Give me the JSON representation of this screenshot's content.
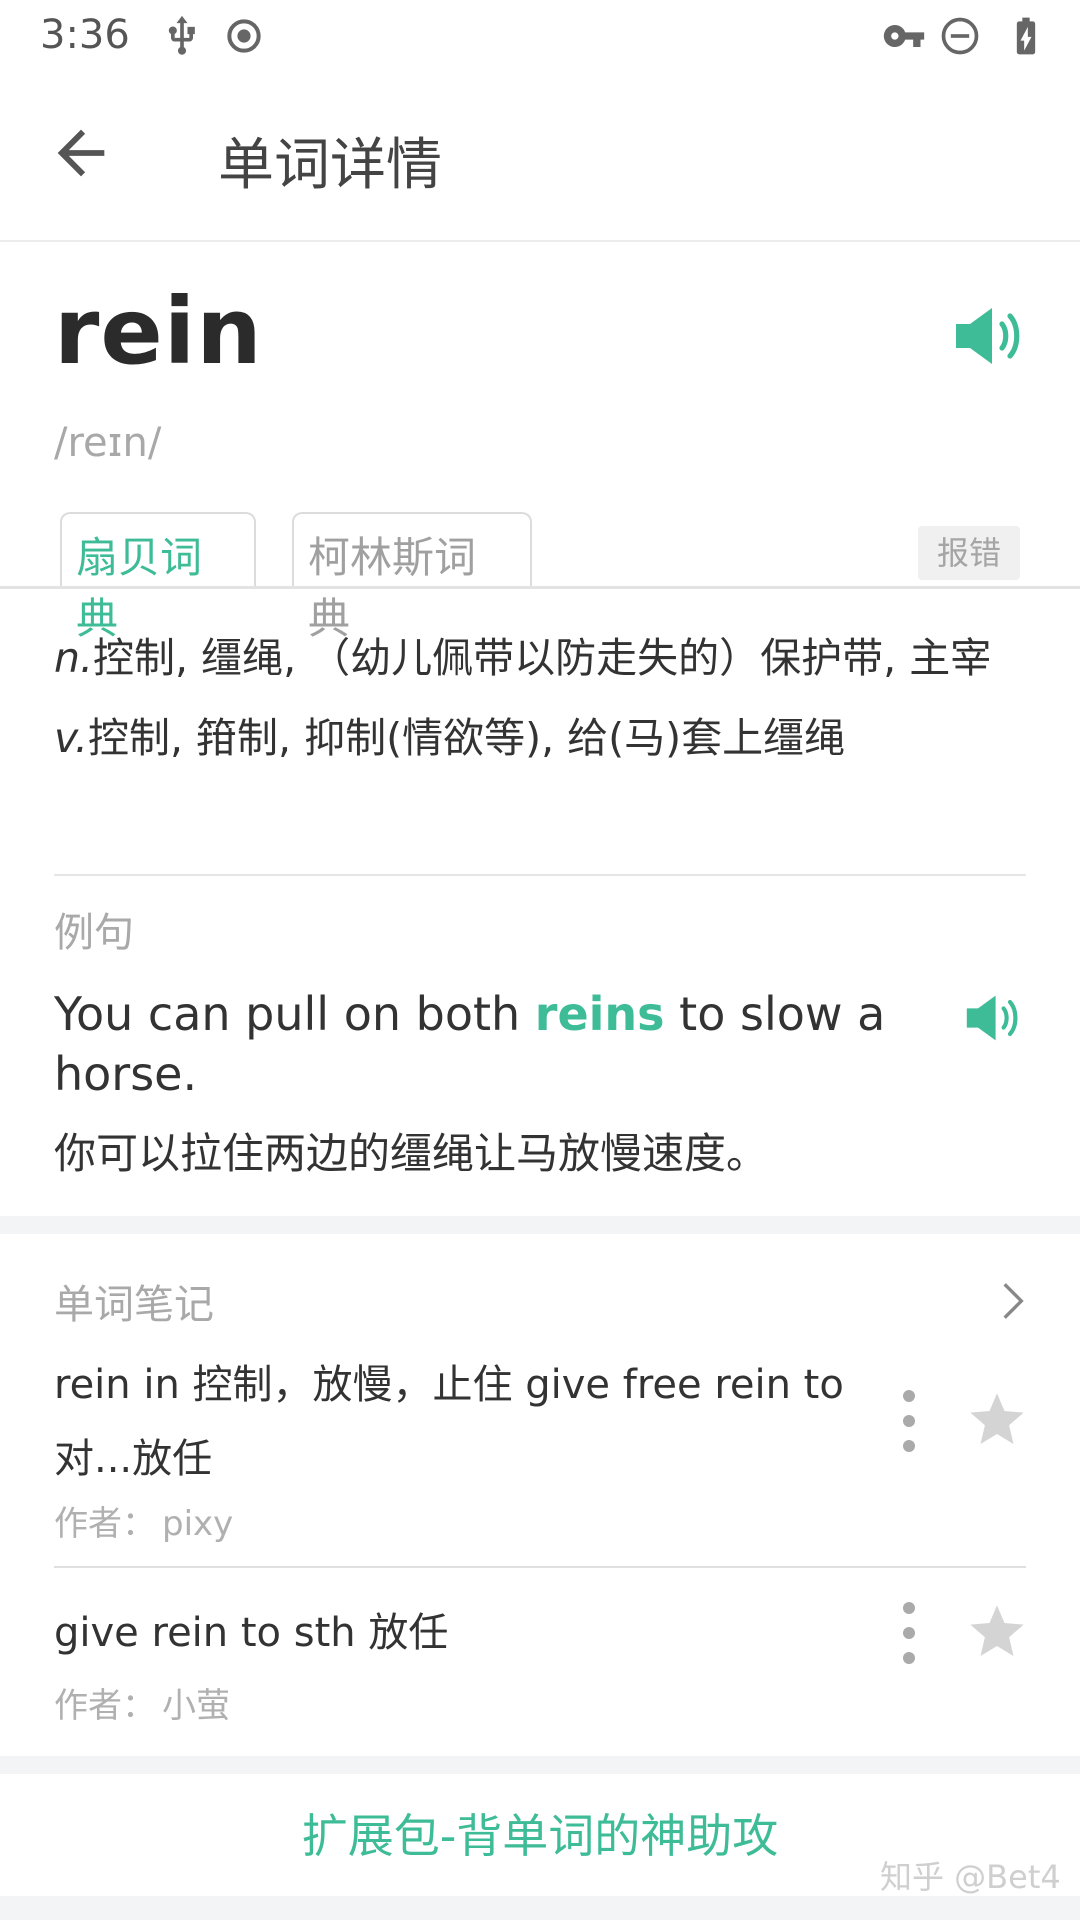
{
  "status_bar": {
    "time": "3:36",
    "left_icons": [
      "usb-icon",
      "record-icon"
    ],
    "right_icons": [
      "vpn-key-icon",
      "do-not-disturb-icon",
      "battery-charging-icon"
    ]
  },
  "app_bar": {
    "back_icon": "arrow-left-icon",
    "title": "单词详情"
  },
  "word": {
    "text": "rein",
    "phonetic": "/reɪn/",
    "sound_icon": "speaker-icon"
  },
  "tabs": [
    {
      "label": "扇贝词典",
      "active": true
    },
    {
      "label": "柯林斯词典",
      "active": false
    }
  ],
  "report_label": "报错",
  "definitions": [
    {
      "pos": "n.",
      "text": "控制, 缰绳, （幼儿佩带以防走失的）保护带, 主宰"
    },
    {
      "pos": "v.",
      "text": "控制, 箝制, 抑制(情欲等), 给(马)套上缰绳"
    }
  ],
  "example": {
    "heading": "例句",
    "en_before": "You can pull on both ",
    "en_highlight": "reins",
    "en_after": " to slow a horse.",
    "zh": "你可以拉住两边的缰绳让马放慢速度。"
  },
  "notes": {
    "heading": "单词笔记",
    "items": [
      {
        "text": "rein in 控制，放慢，止住 give free rein to 对...放任",
        "author_label": "作者：",
        "author": "pixy"
      },
      {
        "text": "give rein to sth 放任",
        "author_label": "作者：",
        "author": "小萤"
      }
    ]
  },
  "promo": "扩展包-背单词的神助攻",
  "watermark": "知乎 @Bet4",
  "colors": {
    "accent": "#3ebc97",
    "muted_text": "#a9a9a9",
    "gap_background": "#f2f4f6"
  }
}
